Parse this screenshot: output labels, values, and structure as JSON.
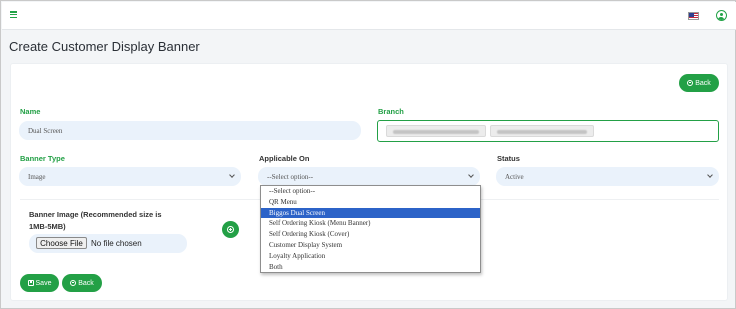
{
  "page": {
    "title": "Create Customer Display Banner"
  },
  "header": {
    "menu_icon": "hamburger-icon",
    "flag_icon": "us-flag-icon",
    "user_icon": "user-circle-icon",
    "accent_color": "#23a046"
  },
  "form": {
    "back_top_label": "Back",
    "name": {
      "label": "Name",
      "value": "Dual Screen"
    },
    "branch": {
      "label": "Branch",
      "chips": [
        "(blurred branch name)",
        "(blurred branch name)"
      ]
    },
    "banner_type": {
      "label": "Banner Type",
      "value": "Image"
    },
    "applicable_on": {
      "label": "Applicable On",
      "value": "--Select option--",
      "options": [
        "--Select option--",
        "QR Menu",
        "Biggos Dual Screen",
        "Self Ordering Kiosk (Menu Banner)",
        "Self Ordering Kiosk (Cover)",
        "Customer Display System",
        "Loyalty Application",
        "Both"
      ],
      "highlighted_option": "Biggos Dual Screen"
    },
    "status": {
      "label": "Status",
      "value": "Active"
    },
    "banner_image": {
      "label_line1": "Banner Image (Recommended size is",
      "label_line2": "1MB-5MB)",
      "choose_file_label": "Choose File",
      "file_status": "No file chosen"
    },
    "save_label": "Save",
    "back_bottom_label": "Back"
  }
}
